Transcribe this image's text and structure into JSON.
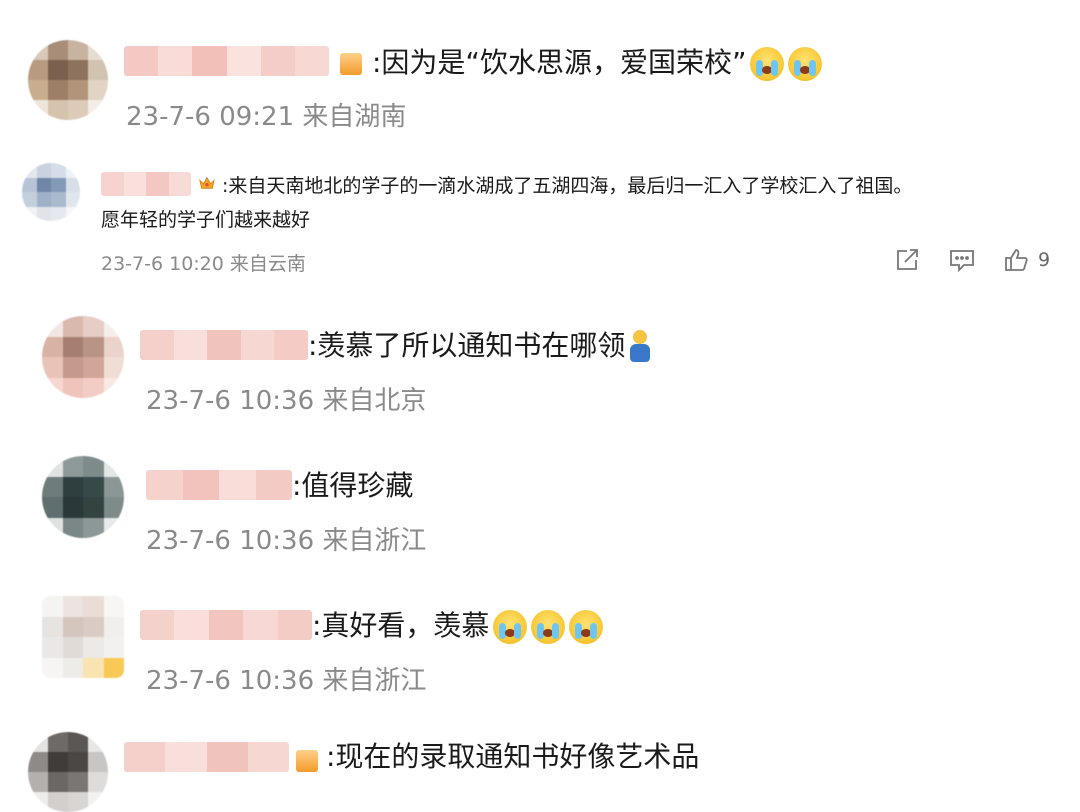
{
  "comments": [
    {
      "text": ":因为是“饮水思源，爱国荣校”",
      "meta": "23-7-6 09:21 来自湖南",
      "emoji_count": 2
    },
    {
      "text_line1": ":来自天南地北的学子的一滴水湖成了五湖四海，最后归一汇入了学校汇入了祖国。",
      "text_line2": "愿年轻的学子们越来越好",
      "meta": "23-7-6 10:20 来自云南",
      "like_count": "9"
    },
    {
      "text": ":羡慕了所以通知书在哪领",
      "meta": "23-7-6 10:36 来自北京"
    },
    {
      "text": ":值得珍藏",
      "meta": "23-7-6 10:36 来自浙江"
    },
    {
      "text": ":真好看，羡慕",
      "meta": "23-7-6 10:36 来自浙江",
      "emoji_count": 3
    },
    {
      "text": ":现在的录取通知书好像艺术品"
    }
  ],
  "icons": [
    "share-icon",
    "comment-icon",
    "like-icon"
  ],
  "colors": {
    "meta_gray": "#8a8a8a",
    "badge_orange": "#f5a623"
  }
}
